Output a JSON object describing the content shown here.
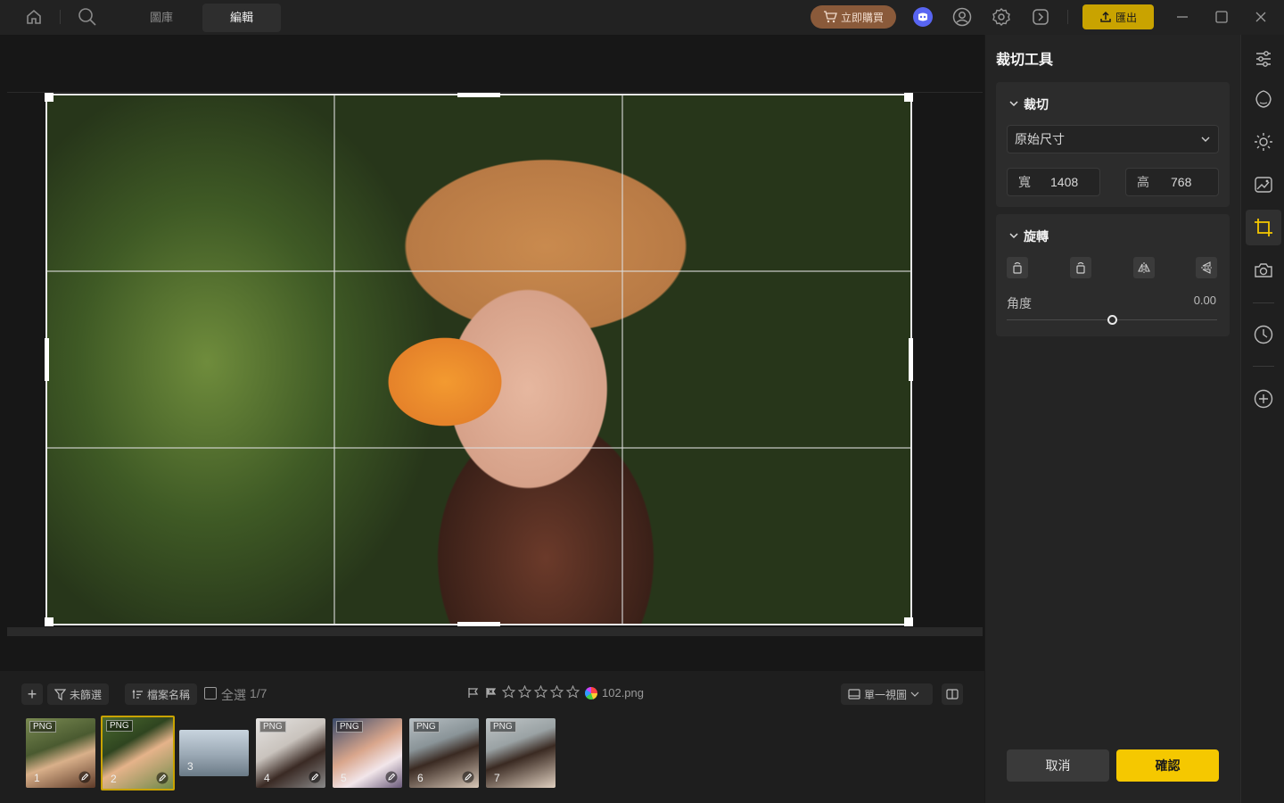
{
  "topbar": {
    "tab_library": "圖庫",
    "tab_edit": "編輯",
    "buy_label": "立即購買",
    "export_label": "匯出"
  },
  "filmstrip": {
    "add": "+",
    "filter_label": "未篩選",
    "sort_label": "檔案名稱",
    "select_all": "全選",
    "count": "1/7",
    "filename": "102.png",
    "view_mode": "單一視圖",
    "thumbs": [
      {
        "tag": "PNG",
        "num": "1"
      },
      {
        "tag": "PNG",
        "num": "2"
      },
      {
        "tag": "",
        "num": "3"
      },
      {
        "tag": "PNG",
        "num": "4"
      },
      {
        "tag": "PNG",
        "num": "5"
      },
      {
        "tag": "PNG",
        "num": "6"
      },
      {
        "tag": "PNG",
        "num": "7"
      }
    ]
  },
  "panel": {
    "title": "裁切工具",
    "crop_section": "裁切",
    "preset": "原始尺寸",
    "width_label": "寬",
    "width_value": "1408",
    "height_label": "高",
    "height_value": "768",
    "rotate_section": "旋轉",
    "angle_label": "角度",
    "angle_value": "0.00",
    "cancel": "取消",
    "confirm": "確認"
  },
  "colors": {
    "accent": "#f5c800",
    "export_bg": "#c9a300",
    "buy_bg": "#8a5a3a",
    "panel_bg": "#242424",
    "selected_thumb_border": "#c9a300"
  },
  "icons": [
    "home-icon",
    "search-icon",
    "cart-icon",
    "discord-icon",
    "user-icon",
    "gear-icon",
    "share-icon",
    "upload-icon",
    "minimize-icon",
    "maximize-icon",
    "close-icon",
    "sliders-icon",
    "lens-icon",
    "sun-icon",
    "image-edit-icon",
    "crop-icon",
    "camera-icon",
    "history-icon",
    "plus-circle-icon",
    "filter-icon",
    "sort-icon",
    "flag-icon",
    "star-icon",
    "color-wheel-icon",
    "single-view-icon",
    "compare-icon",
    "chevron-down-icon",
    "rotate-left-icon",
    "rotate-right-icon",
    "flip-horizontal-icon",
    "flip-vertical-icon"
  ]
}
